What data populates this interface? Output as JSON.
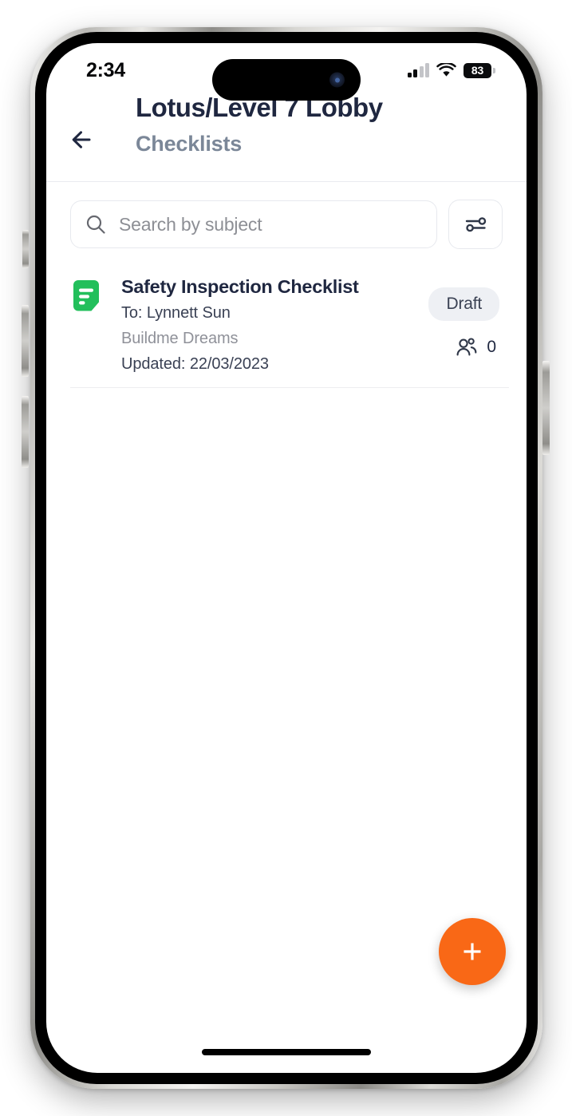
{
  "status_bar": {
    "time": "2:34",
    "signal_icon": "cellular-signal-icon",
    "wifi_icon": "wifi-icon",
    "battery_level": "83",
    "battery_icon": "battery-icon"
  },
  "header": {
    "back_icon": "back-arrow-icon",
    "title": "Lotus/Level 7 Lobby",
    "subtitle": "Checklists"
  },
  "search": {
    "placeholder": "Search by subject",
    "value": "",
    "search_icon": "search-icon",
    "filter_icon": "filter-sliders-icon"
  },
  "list": {
    "items": [
      {
        "doc_icon": "checklist-document-icon",
        "icon_color": "#22bf5b",
        "title": "Safety Inspection Checklist",
        "recipient": "To: Lynnett Sun",
        "company": "Buildme Dreams",
        "updated": "Updated: 22/03/2023",
        "status": "Draft",
        "status_bg": "#eef0f4",
        "assignees_icon": "people-icon",
        "assignees_count": "0"
      }
    ]
  },
  "fab": {
    "label": "+",
    "icon": "plus-icon",
    "color": "#f96816"
  },
  "home_indicator": "home-indicator-bar"
}
